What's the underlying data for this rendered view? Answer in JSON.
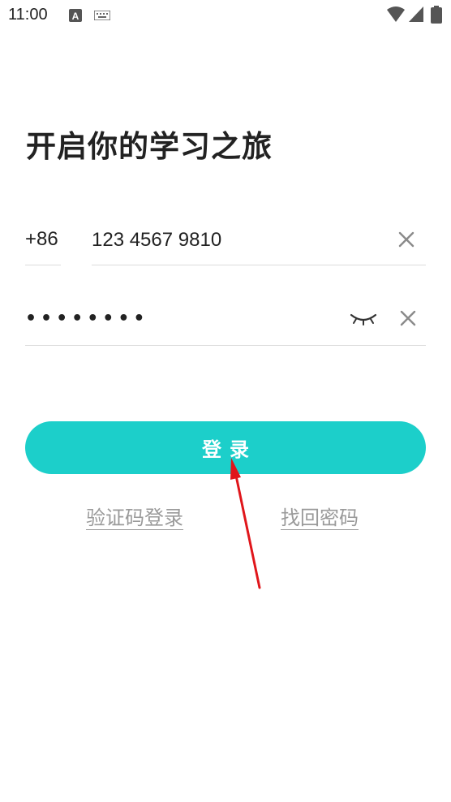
{
  "status_bar": {
    "time": "11:00",
    "icons": [
      "text-a-icon",
      "keyboard-icon",
      "wifi-icon",
      "signal-icon",
      "battery-icon"
    ]
  },
  "page": {
    "title": "开启你的学习之旅"
  },
  "phone": {
    "country_code": "+86",
    "value": "123 4567 9810",
    "clear_icon": "close-icon"
  },
  "password": {
    "value": "••••••••",
    "visibility_icon": "eye-closed-icon",
    "clear_icon": "close-icon"
  },
  "login": {
    "label": "登录"
  },
  "links": {
    "sms_login": "验证码登录",
    "forgot_password": "找回密码"
  },
  "colors": {
    "accent": "#1ccfca",
    "annotation_arrow": "#e0161b"
  }
}
